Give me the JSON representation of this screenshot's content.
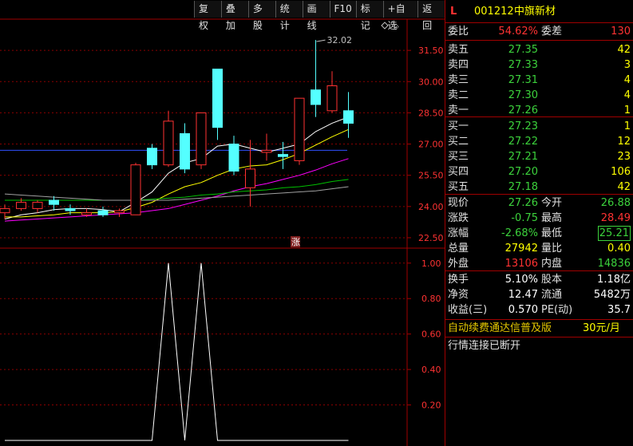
{
  "toolbar": {
    "buttons": [
      "复权",
      "叠加",
      "多股",
      "统计",
      "画线",
      "F10",
      "标记",
      "+自选",
      "返回"
    ]
  },
  "stock": {
    "marker": "L",
    "code": "001212",
    "name": "中旗新材"
  },
  "order_ratio": {
    "label_ratio": "委比",
    "ratio": "54.62%",
    "label_diff": "委差",
    "diff": "130"
  },
  "asks": [
    {
      "label": "卖五",
      "price": "27.35",
      "vol": "42"
    },
    {
      "label": "卖四",
      "price": "27.33",
      "vol": "3"
    },
    {
      "label": "卖三",
      "price": "27.31",
      "vol": "4"
    },
    {
      "label": "卖二",
      "price": "27.30",
      "vol": "4"
    },
    {
      "label": "卖一",
      "price": "27.26",
      "vol": "1"
    }
  ],
  "bids": [
    {
      "label": "买一",
      "price": "27.23",
      "vol": "1"
    },
    {
      "label": "买二",
      "price": "27.22",
      "vol": "12"
    },
    {
      "label": "买三",
      "price": "27.21",
      "vol": "23"
    },
    {
      "label": "买四",
      "price": "27.20",
      "vol": "106"
    },
    {
      "label": "买五",
      "price": "27.18",
      "vol": "42"
    }
  ],
  "stats": [
    {
      "l1": "现价",
      "v1": "27.26",
      "c1": "green",
      "l2": "今开",
      "v2": "26.88",
      "c2": "green"
    },
    {
      "l1": "涨跌",
      "v1": "-0.75",
      "c1": "green",
      "l2": "最高",
      "v2": "28.49",
      "c2": "red"
    },
    {
      "l1": "涨幅",
      "v1": "-2.68%",
      "c1": "green",
      "l2": "最低",
      "v2": "25.21",
      "c2": "green"
    },
    {
      "l1": "总量",
      "v1": "27942",
      "c1": "yellow",
      "l2": "量比",
      "v2": "0.40",
      "c2": "yellow"
    },
    {
      "l1": "外盘",
      "v1": "13106",
      "c1": "red",
      "l2": "内盘",
      "v2": "14836",
      "c2": "green"
    }
  ],
  "fundamentals": [
    {
      "l1": "换手",
      "v1": "5.10%",
      "l2": "股本",
      "v2": "1.18亿"
    },
    {
      "l1": "净资",
      "v1": "12.47",
      "l2": "流通",
      "v2": "5482万"
    },
    {
      "l1": "收益(三)",
      "v1": "0.570",
      "l2": "PE(动)",
      "v2": "35.7"
    }
  ],
  "promo": {
    "text": "自动续费通达信普及版",
    "price": "30元/月"
  },
  "status": "行情连接已断开",
  "chart_data": [
    {
      "type": "candlestick",
      "title": "",
      "ylim": [
        22.0,
        33.0
      ],
      "y_ticks": [
        "31.50",
        "30.00",
        "28.50",
        "27.00",
        "25.50",
        "24.00",
        "22.50"
      ],
      "y_tick_values": [
        31.5,
        30.0,
        28.5,
        27.0,
        25.5,
        24.0,
        22.5
      ],
      "annotation_high": "32.02",
      "limit_up_label": "涨",
      "candles": [
        {
          "o": 23.7,
          "h": 24.1,
          "l": 23.4,
          "c": 23.9
        },
        {
          "o": 23.9,
          "h": 24.4,
          "l": 23.8,
          "c": 24.2
        },
        {
          "o": 23.9,
          "h": 24.3,
          "l": 23.7,
          "c": 24.2
        },
        {
          "o": 24.3,
          "h": 24.5,
          "l": 23.8,
          "c": 24.1
        },
        {
          "o": 23.9,
          "h": 24.1,
          "l": 23.6,
          "c": 23.8
        },
        {
          "o": 23.6,
          "h": 23.9,
          "l": 23.5,
          "c": 23.7
        },
        {
          "o": 23.8,
          "h": 24.0,
          "l": 23.5,
          "c": 23.6
        },
        {
          "o": 23.7,
          "h": 23.9,
          "l": 23.5,
          "c": 23.8
        },
        {
          "o": 23.6,
          "h": 26.1,
          "l": 23.6,
          "c": 26.0
        },
        {
          "o": 26.8,
          "h": 27.0,
          "l": 25.8,
          "c": 26.0
        },
        {
          "o": 26.0,
          "h": 28.6,
          "l": 25.9,
          "c": 28.1
        },
        {
          "o": 27.5,
          "h": 28.0,
          "l": 25.6,
          "c": 25.8
        },
        {
          "o": 26.0,
          "h": 28.5,
          "l": 25.8,
          "c": 28.5
        },
        {
          "o": 30.6,
          "h": 30.6,
          "l": 27.2,
          "c": 27.8
        },
        {
          "o": 27.0,
          "h": 27.4,
          "l": 25.5,
          "c": 25.7
        },
        {
          "o": 24.9,
          "h": 27.2,
          "l": 24.0,
          "c": 25.8
        },
        {
          "o": 26.6,
          "h": 27.5,
          "l": 26.2,
          "c": 26.7
        },
        {
          "o": 26.5,
          "h": 27.1,
          "l": 25.8,
          "c": 26.4
        },
        {
          "o": 26.2,
          "h": 29.2,
          "l": 26.0,
          "c": 29.2
        },
        {
          "o": 29.6,
          "h": 32.0,
          "l": 28.3,
          "c": 28.9
        },
        {
          "o": 28.6,
          "h": 30.5,
          "l": 28.5,
          "c": 29.8
        },
        {
          "o": 28.6,
          "h": 29.5,
          "l": 27.3,
          "c": 28.0
        }
      ],
      "ma": [
        {
          "color": "#ffffff",
          "values": [
            23.4,
            23.6,
            23.7,
            23.85,
            23.9,
            23.9,
            23.85,
            23.75,
            24.2,
            24.7,
            25.6,
            26.1,
            26.3,
            26.9,
            27.0,
            26.8,
            26.6,
            26.8,
            27.0,
            27.6,
            28.0,
            28.3
          ]
        },
        {
          "color": "#ffff00",
          "values": [
            23.5,
            23.5,
            23.55,
            23.6,
            23.7,
            23.7,
            23.7,
            23.75,
            23.95,
            24.2,
            24.6,
            24.95,
            25.15,
            25.5,
            25.8,
            25.95,
            26.0,
            26.25,
            26.55,
            26.95,
            27.35,
            27.7
          ]
        },
        {
          "color": "#ff00ff",
          "values": [
            23.3,
            23.35,
            23.4,
            23.45,
            23.5,
            23.55,
            23.6,
            23.65,
            23.7,
            23.8,
            23.9,
            24.1,
            24.3,
            24.5,
            24.75,
            24.95,
            25.1,
            25.3,
            25.5,
            25.75,
            26.05,
            26.3
          ]
        },
        {
          "color": "#00c000",
          "values": [
            24.3,
            24.3,
            24.3,
            24.3,
            24.3,
            24.3,
            24.3,
            24.3,
            24.3,
            24.35,
            24.4,
            24.45,
            24.55,
            24.6,
            24.7,
            24.75,
            24.8,
            24.9,
            24.95,
            25.05,
            25.2,
            25.3
          ]
        },
        {
          "color": "#a0a0a0",
          "values": [
            24.6,
            24.55,
            24.5,
            24.45,
            24.4,
            24.35,
            24.3,
            24.3,
            24.3,
            24.3,
            24.3,
            24.35,
            24.4,
            24.45,
            24.5,
            24.55,
            24.6,
            24.65,
            24.7,
            24.75,
            24.85,
            24.95
          ]
        }
      ],
      "reference_line": {
        "color": "#3050ff",
        "value": 26.7
      }
    },
    {
      "type": "line",
      "title": "",
      "ylim": [
        0,
        1.08
      ],
      "y_ticks": [
        "1.00",
        "0.80",
        "0.60",
        "0.40",
        "0.20"
      ],
      "y_tick_values": [
        1.0,
        0.8,
        0.6,
        0.4,
        0.2
      ],
      "x": [
        0,
        1,
        2,
        3,
        4,
        5,
        6,
        7,
        8,
        9,
        10,
        11,
        12,
        13,
        14,
        15,
        16,
        17,
        18,
        19,
        20,
        21
      ],
      "values": [
        0,
        0,
        0,
        0,
        0,
        0,
        0,
        0,
        0,
        0,
        1,
        0,
        1,
        0,
        0,
        0,
        0,
        0,
        0,
        0,
        0,
        0
      ]
    }
  ]
}
